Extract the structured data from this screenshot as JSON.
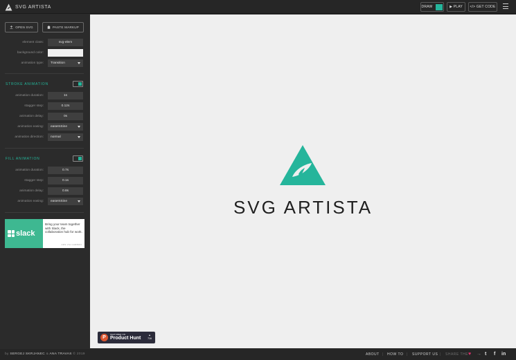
{
  "app": {
    "name": "SVG ARTISTA"
  },
  "toolbar": {
    "draw_label": "DRAW",
    "play_label": "▶ PLAY",
    "get_code_label": "</> GET CODE"
  },
  "sidebar": {
    "open_svg_label": "OPEN SVG",
    "paste_markup_label": "PASTE MARKUP",
    "fields": {
      "element_class": {
        "label": "element class:",
        "value": "svg-elem"
      },
      "background_color": {
        "label": "background color:",
        "value": ""
      },
      "animation_type": {
        "label": "animation type:",
        "value": "Transition"
      }
    },
    "stroke": {
      "title": "STROKE ANIMATION",
      "enabled": true,
      "duration": {
        "label": "animation duration:",
        "value": "1s"
      },
      "stagger": {
        "label": "stagger step:",
        "value": "0.12s"
      },
      "delay": {
        "label": "animation delay:",
        "value": "0s"
      },
      "easing": {
        "label": "animation easing:",
        "value": "easeInSine"
      },
      "direction": {
        "label": "animation direction:",
        "value": "normal"
      }
    },
    "fill": {
      "title": "FILL ANIMATION",
      "enabled": true,
      "duration": {
        "label": "animation duration:",
        "value": "0.7s"
      },
      "stagger": {
        "label": "stagger step:",
        "value": "0.1s"
      },
      "delay": {
        "label": "animation delay:",
        "value": "0.8s"
      },
      "easing": {
        "label": "animation easing:",
        "value": "easeInSine"
      }
    },
    "ad": {
      "brand": "slack",
      "text": "Bring your team together with Slack, the collaboration hub for work.",
      "via": "ADS VIA CARBON"
    }
  },
  "canvas": {
    "logo_text": "SVG ARTISTA",
    "product_hunt": {
      "featured": "FEATURED ON",
      "name": "Product Hunt",
      "arrow": "▲",
      "count": "716"
    }
  },
  "footer": {
    "by": "by",
    "author1": "SERGEJ SKRJANEC",
    "amp": "&",
    "author2": "ANA TRAVAS",
    "year": "© 2019",
    "links": {
      "about": "ABOUT",
      "how_to": "HOW TO",
      "support": "SUPPORT US"
    },
    "share_label": "SHARE THE",
    "arrow": "→",
    "social": {
      "twitter": "t",
      "facebook": "f",
      "linkedin": "in"
    }
  },
  "colors": {
    "accent": "#25b59b",
    "panel": "#2b2b2b",
    "canvas": "#efefef",
    "heart": "#e0306e"
  },
  "icons": [
    "artista-logo-icon",
    "upload-icon",
    "paste-icon",
    "menu-icon",
    "heart-icon",
    "twitter-icon",
    "facebook-icon",
    "linkedin-icon",
    "product-hunt-icon"
  ]
}
